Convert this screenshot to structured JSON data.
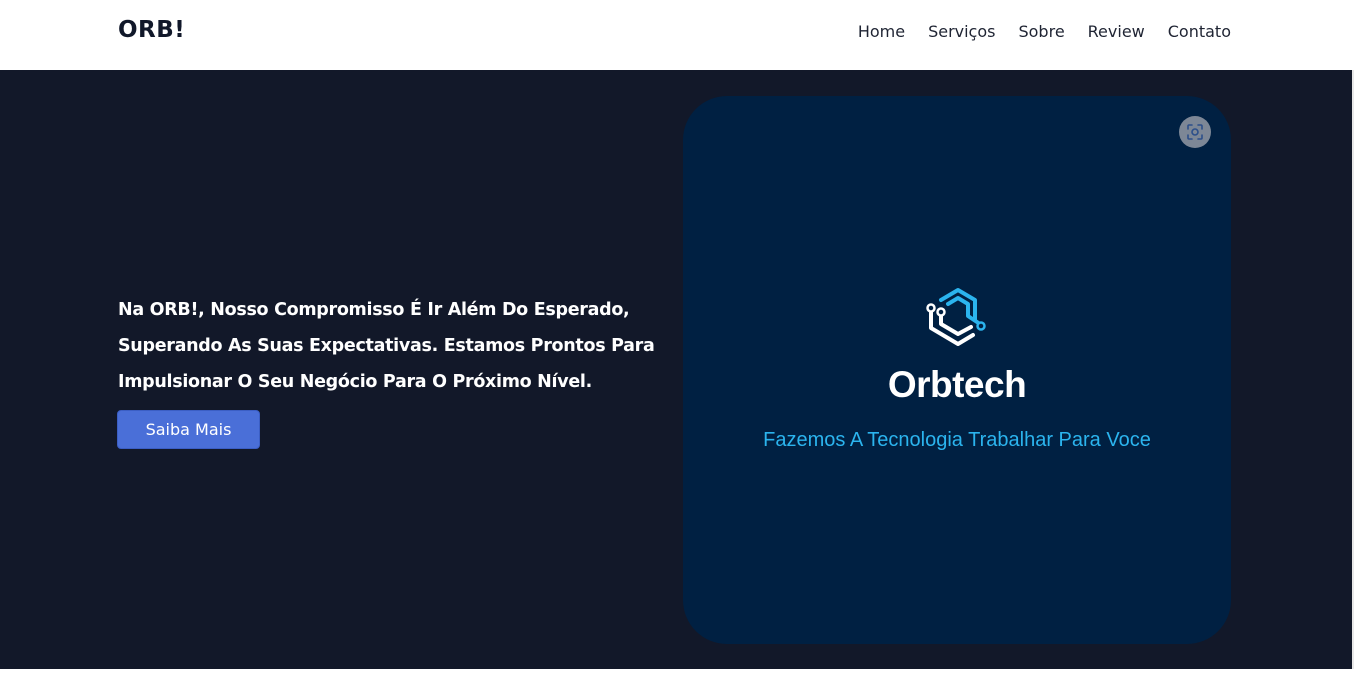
{
  "navbar": {
    "brand": "ORB!",
    "links": [
      "Home",
      "Serviços",
      "Sobre",
      "Review",
      "Contato"
    ]
  },
  "hero": {
    "headline": "Na ORB!, Nosso Compromisso É Ir Além Do Esperado, Superando As Suas Expectativas. Estamos Prontos Para Impulsionar O Seu Negócio Para O Próximo Nível.",
    "cta_label": "Saiba Mais"
  },
  "card": {
    "logo_icon": "hexagon-circuit-logo-icon",
    "name": "Orbtech",
    "tagline": "Fazemos A Tecnologia Trabalhar Para Voce",
    "overlay_icon": "lens-search-icon"
  },
  "colors": {
    "hero_bg": "#121829",
    "card_bg": "#002042",
    "accent": "#2bb4ee",
    "button": "#4a6fd8"
  }
}
